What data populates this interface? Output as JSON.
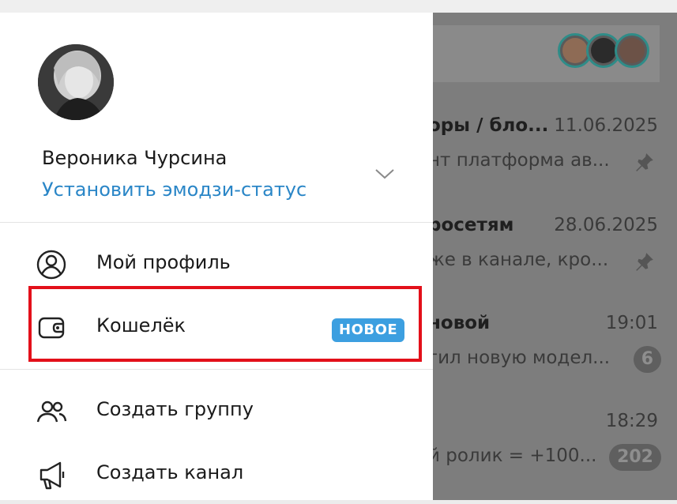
{
  "drawer": {
    "user_name": "Вероника Чурсина",
    "status_link": "Установить эмодзи-статус",
    "menu": [
      {
        "label": "Мой профиль",
        "icon": "profile-icon"
      },
      {
        "label": "Кошелёк",
        "icon": "wallet-icon",
        "badge": "НОВОЕ"
      },
      {
        "label": "Создать группу",
        "icon": "group-icon"
      },
      {
        "label": "Создать канал",
        "icon": "megaphone-icon"
      }
    ]
  },
  "chats": [
    {
      "title": "оры / бло...",
      "date": "11.06.2025",
      "preview": "нт  платформа ав...",
      "pinned": true
    },
    {
      "title": "росетям",
      "date": "28.06.2025",
      "preview": "же в канале, кро...",
      "pinned": true
    },
    {
      "title": "новой",
      "date": "19:01",
      "preview": "гил новую модел...",
      "unread": "6"
    },
    {
      "title": "",
      "date": "18:29",
      "preview": "й ролик = +100...",
      "unread": "202"
    }
  ],
  "colors": {
    "accent": "#2a86c7",
    "badge": "#3c9fe0",
    "highlight": "#e3101a",
    "dim_overlay": "#7d7d7d"
  }
}
